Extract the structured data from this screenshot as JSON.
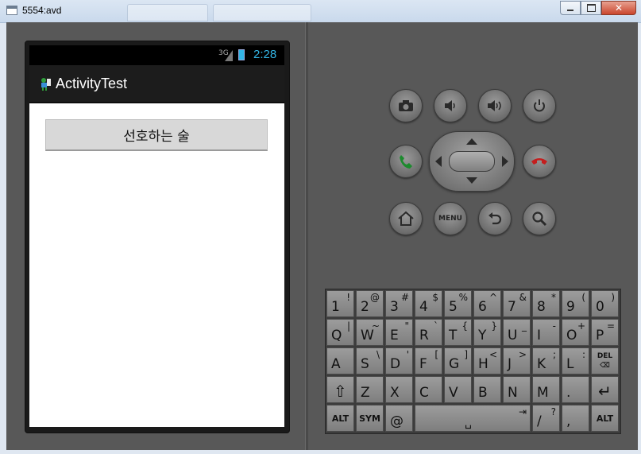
{
  "window": {
    "title": "5554:avd",
    "controls": {
      "minimize": "—",
      "maximize": "□",
      "close": "✕"
    },
    "icons": {
      "app": "window-icon"
    }
  },
  "status_bar": {
    "network": "3G",
    "time": "2:28"
  },
  "app": {
    "title": "ActivityTest",
    "button_label": "선호하는 술"
  },
  "hardware_buttons": {
    "row1": [
      "camera-icon",
      "volume-down-icon",
      "volume-up-icon",
      "power-icon"
    ],
    "call": "call-icon",
    "end_call": "end-call-icon",
    "row3": [
      "home-icon",
      "menu-button",
      "back-icon",
      "search-icon"
    ],
    "menu_label": "MENU"
  },
  "keyboard": {
    "row1": [
      {
        "m": "1",
        "s": "!"
      },
      {
        "m": "2",
        "s": "@"
      },
      {
        "m": "3",
        "s": "#"
      },
      {
        "m": "4",
        "s": "$"
      },
      {
        "m": "5",
        "s": "%"
      },
      {
        "m": "6",
        "s": "^"
      },
      {
        "m": "7",
        "s": "&"
      },
      {
        "m": "8",
        "s": "*"
      },
      {
        "m": "9",
        "s": "("
      },
      {
        "m": "0",
        "s": ")"
      }
    ],
    "row2": [
      {
        "m": "Q",
        "s": "|"
      },
      {
        "m": "W",
        "s": "~"
      },
      {
        "m": "E",
        "s": "\""
      },
      {
        "m": "R",
        "s": "`"
      },
      {
        "m": "T",
        "s": "{"
      },
      {
        "m": "Y",
        "s": "}"
      },
      {
        "m": "U",
        "s": "_"
      },
      {
        "m": "I",
        "s": "-"
      },
      {
        "m": "O",
        "s": "+"
      },
      {
        "m": "P",
        "s": "="
      }
    ],
    "row3": [
      {
        "m": "A",
        "s": ""
      },
      {
        "m": "S",
        "s": "\\"
      },
      {
        "m": "D",
        "s": "'"
      },
      {
        "m": "F",
        "s": "["
      },
      {
        "m": "G",
        "s": "]"
      },
      {
        "m": "H",
        "s": "<"
      },
      {
        "m": "J",
        "s": ">"
      },
      {
        "m": "K",
        "s": ";"
      },
      {
        "m": "L",
        "s": ":"
      },
      {
        "m": "",
        "s": "DEL"
      }
    ],
    "row4": [
      {
        "m": "⇧",
        "s": ""
      },
      {
        "m": "Z",
        "s": ""
      },
      {
        "m": "X",
        "s": ""
      },
      {
        "m": "C",
        "s": ""
      },
      {
        "m": "V",
        "s": ""
      },
      {
        "m": "B",
        "s": ""
      },
      {
        "m": "N",
        "s": ""
      },
      {
        "m": "M",
        "s": ""
      },
      {
        "m": ".",
        "s": ""
      },
      {
        "m": "↵",
        "s": ""
      }
    ],
    "row5": {
      "alt": "ALT",
      "sym": "SYM",
      "at": "@",
      "space": "␣",
      "tab": "⇥",
      "slash": "/",
      "question": "?",
      "comma": ",",
      "alt2": "ALT"
    }
  }
}
